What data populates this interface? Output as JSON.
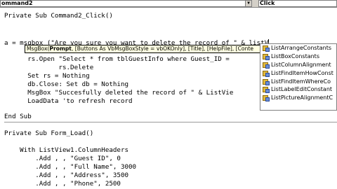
{
  "toolbar": {
    "object_combo": "ommand2",
    "procedure_combo": "Click"
  },
  "code_lines": [
    "Private Sub Command2_Click()",
    "",
    "a = msgbox (\"Are you sure you want to delete the record of \" & listV",
    "",
    "      rs.Open \"Select * from tblGuestInfo where Guest_ID =",
    "              rs.Delete",
    "      Set rs = Nothing",
    "      db.Close: Set db = Nothing",
    "      MsgBox \"Succesfully deleted the record of \" & ListVie",
    "      LoadData 'to refresh record",
    "",
    "",
    "End Sub",
    "",
    "Private Sub Form_Load()",
    "",
    "    With ListView1.ColumnHeaders",
    "        .Add , , \"Guest ID\", 0",
    "        .Add , , \"Full Name\", 3000",
    "        .Add , , \"Address\", 3500",
    "        .Add , , \"Phone\", 2500"
  ],
  "tooltip": {
    "prefix": "MsgBox(",
    "bold_param": "Prompt",
    "rest": ", [Buttons As VbMsgBoxStyle = vbOKOnly], [Title], [HelpFile], [Conte"
  },
  "autocomplete": {
    "items": [
      "ListArrangeConstants",
      "ListBoxConstants",
      "ListColumnAlignment",
      "ListFindItemHowConst",
      "ListFindItemWhereCo",
      "ListLabelEditConstant",
      "ListPictureAlignmentC"
    ],
    "item_icon": "enum-icon",
    "highlight_color": "#ffffe1"
  }
}
